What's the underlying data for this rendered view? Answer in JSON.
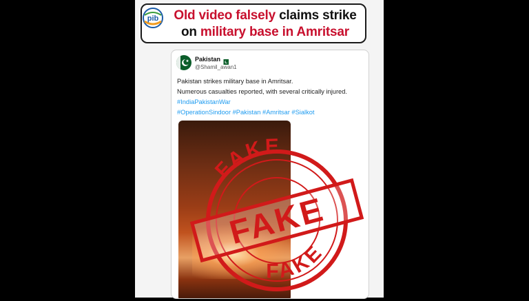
{
  "headline": {
    "part1_red": "Old video falsely",
    "part1_dark": " claims strike",
    "part2_dark": "on ",
    "part2_red": "military base in Amritsar"
  },
  "logo": {
    "icon": "pib-logo",
    "text": "pib"
  },
  "tweet": {
    "account_name": "Pakistan",
    "account_handle": "@Shamil_awan1",
    "line1": "Pakistan strikes military base in Amritsar.",
    "line2": "Numerous casualties reported, with several critically injured.",
    "hashtags_line1": "#IndiaPakistanWar",
    "hashtags_line2": "#OperationSindoor #Pakistan #Amritsar #Sialkot"
  },
  "stamp": {
    "main_text": "FAKE",
    "top_arc_text": "FAKE",
    "bottom_arc_text": "FAKE",
    "color": "#d11a1a"
  },
  "colors": {
    "accent_red": "#c8102e",
    "link_blue": "#1d9bf0"
  }
}
